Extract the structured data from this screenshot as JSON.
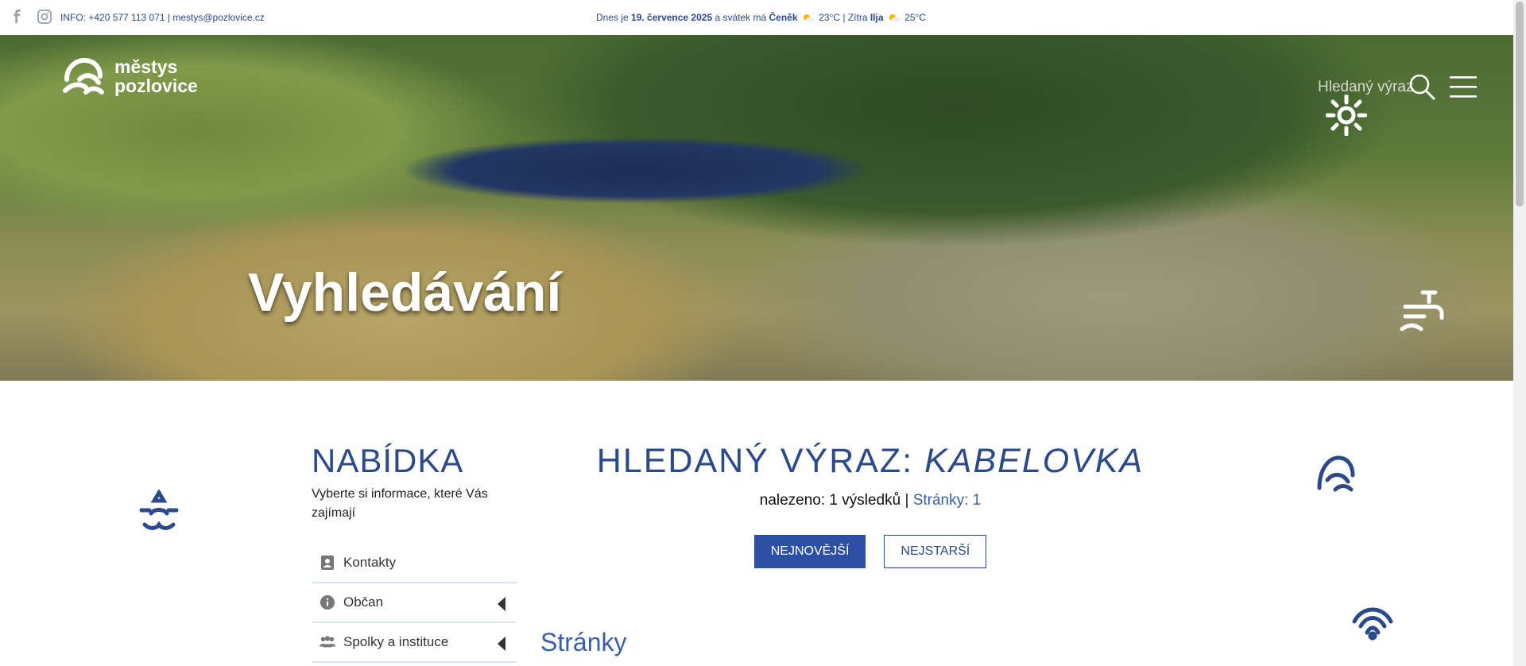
{
  "topbar": {
    "info_prefix": "INFO: +420 577 113 071 |",
    "email": "mestys@pozlovice.cz",
    "today_prefix": "Dnes je",
    "today_date": "19. července 2025",
    "today_mid": "a svátek má",
    "today_name": "Čeněk",
    "today_temp": "23°C | Zítra",
    "tomorrow_name": "Ilja",
    "tomorrow_temp": "25°C"
  },
  "brand": {
    "line1": "městys",
    "line2": "pozlovice"
  },
  "hero": {
    "title": "Vyhledávání"
  },
  "search": {
    "placeholder": "Hledaný výraz"
  },
  "sidebar": {
    "title": "NABÍDKA",
    "subtitle": "Vyberte si informace, které Vás zajímají",
    "items": [
      {
        "label": "Kontakty",
        "icon": "contact-card-icon",
        "submenu": false
      },
      {
        "label": "Občan",
        "icon": "info-icon",
        "submenu": true
      },
      {
        "label": "Spolky a instituce",
        "icon": "people-icon",
        "submenu": true
      }
    ]
  },
  "main": {
    "heading_label": "HLEDANÝ VÝRAZ:",
    "heading_term": "KABELOVKA",
    "found_text": "nalezeno: 1 výsledků |",
    "pages_text": "Stránky: 1",
    "btn_newest": "NEJNOVĚJŠÍ",
    "btn_oldest": "NEJSTARŠÍ",
    "section_title": "Stránky"
  },
  "colors": {
    "primary": "#2b4a8b",
    "button": "#2b50a6",
    "link": "#3a5ea8"
  }
}
